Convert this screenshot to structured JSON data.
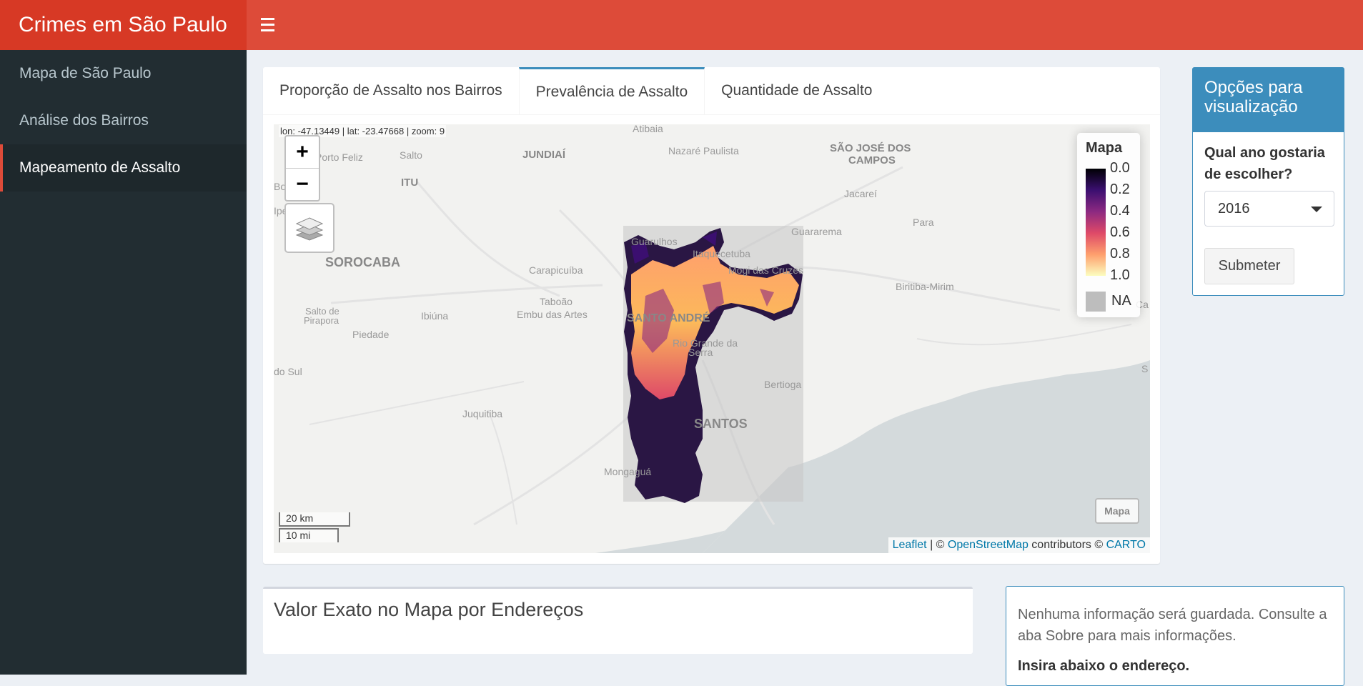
{
  "header": {
    "title": "Crimes em São Paulo",
    "menu_icon": "hamburger-icon"
  },
  "sidebar": {
    "items": [
      {
        "label": "Mapa de São Paulo",
        "active": false
      },
      {
        "label": "Análise dos Bairros",
        "active": false
      },
      {
        "label": "Mapeamento de Assalto",
        "active": true
      }
    ]
  },
  "tabs": [
    {
      "label": "Proporção de Assalto nos Bairros",
      "active": false
    },
    {
      "label": "Prevalência de Assalto",
      "active": true
    },
    {
      "label": "Quantidade de Assalto",
      "active": false
    }
  ],
  "map": {
    "coords": "lon: -47.13449 | lat: -23.47668 | zoom: 9",
    "zoom_in": "+",
    "zoom_out": "−",
    "legend": {
      "title": "Mapa",
      "ticks": [
        "0.0",
        "0.2",
        "0.4",
        "0.6",
        "0.8",
        "1.0"
      ],
      "na_label": "NA",
      "palette": [
        "#000004",
        "#3b0f70",
        "#8c2981",
        "#de4968",
        "#fe9f6d",
        "#fcfdbf"
      ]
    },
    "layer_button": "Mapa",
    "scale": {
      "km": "20 km",
      "mi": "10 mi"
    },
    "attribution": {
      "leaflet": "Leaflet",
      "sep": " | © ",
      "osm": "OpenStreetMap",
      "contrib": " contributors © ",
      "carto": "CARTO"
    },
    "places": {
      "atibaia": "Atibaia",
      "porto_feliz": "Porto Feliz",
      "salto": "Salto",
      "jundiai": "JUNDIAÍ",
      "nazare": "Nazaré Paulista",
      "sjc1": "SÃO JOSÉ DOS",
      "sjc2": "CAMPOS",
      "itu": "ITU",
      "jacarei": "Jacareí",
      "guararema": "Guararema",
      "sorocaba": "SOROCABA",
      "guarulhos": "Guarulhos",
      "itaquecetuba": "Itaquecetuba",
      "carapicuiba": "Carapicuíba",
      "mogi": "Mogi das Cruzes",
      "biritiba": "Biritiba-Mirim",
      "taboao": "Taboão",
      "embu": "Embu das Artes",
      "santo_andre": "SANTO ANDRÉ",
      "salto_pir1": "Salto de",
      "salto_pir2": "Pirapora",
      "ibiuna": "Ibiúna",
      "piedade": "Piedade",
      "rio_grande1": "Rio Grande da",
      "rio_grande2": "Serra",
      "bertioga": "Bertioga",
      "juquitiba": "Juquitiba",
      "santos": "SANTOS",
      "mongagua": "Mongaguá",
      "do_sul": "do Sul",
      "para": "Para",
      "bo": "Bo",
      "ipe": "Ipe",
      "ca": "Ca",
      "s": "S"
    }
  },
  "options": {
    "title": "Opções para visualização",
    "question": "Qual ano gostaria de escolher?",
    "year": "2016",
    "submit": "Submeter"
  },
  "address_box": {
    "title": "Valor Exato no Mapa por Endereços"
  },
  "info_box": {
    "text": "Nenhuma informação será guardada. Consulte a aba Sobre para mais informações.",
    "bold": "Insira abaixo o endereço."
  }
}
